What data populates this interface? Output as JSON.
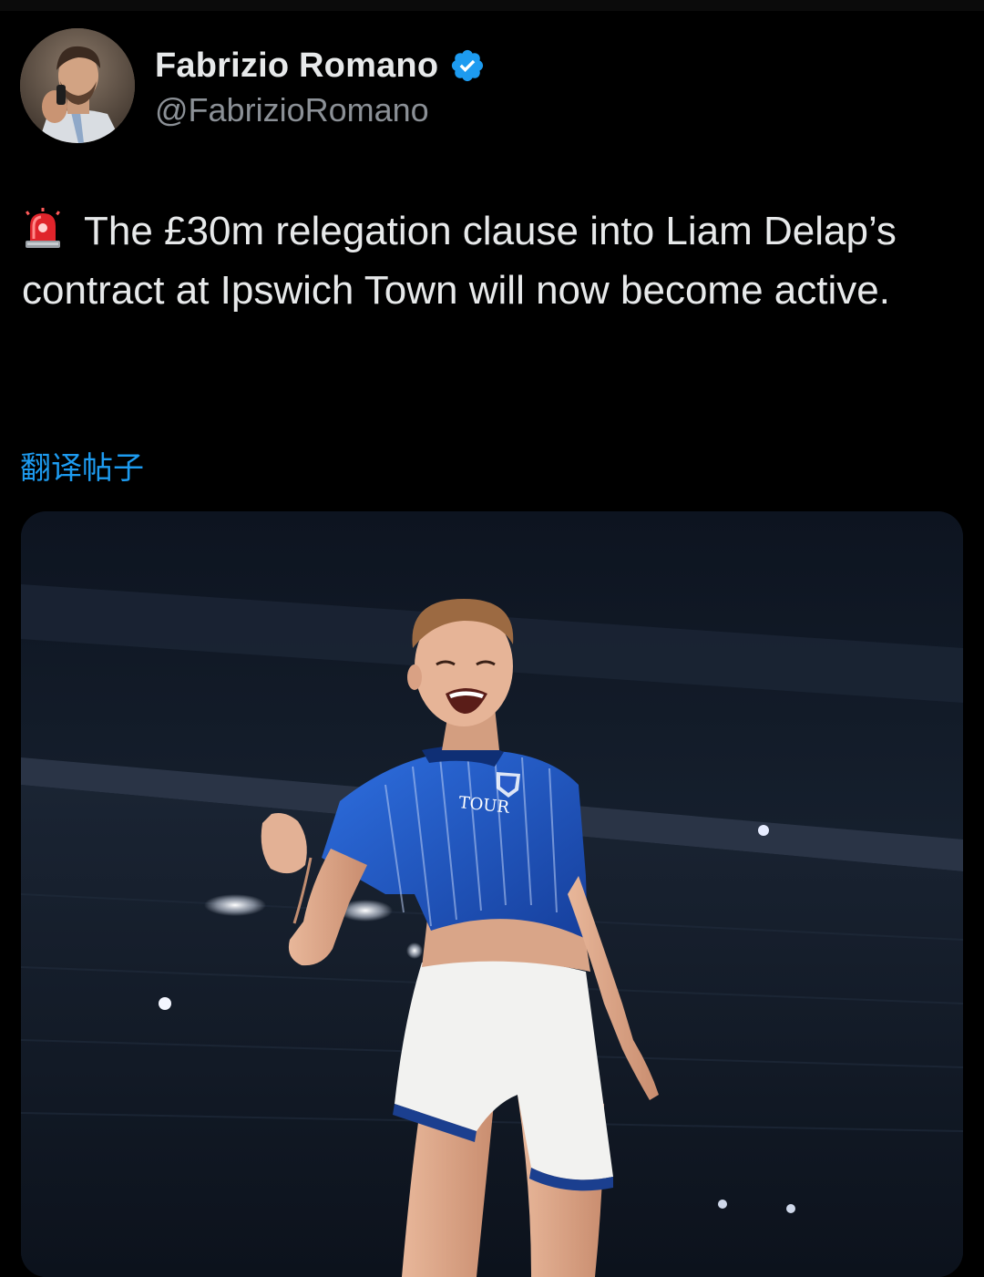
{
  "author": {
    "display_name": "Fabrizio Romano",
    "handle": "@FabrizioRomano",
    "verified": true,
    "verified_color": "#1d9bf0"
  },
  "tweet": {
    "emoji": "siren-icon",
    "text": "The £30m relegation clause into Liam Delap’s contract at Ipswich Town will now become active."
  },
  "translate_label": "翻译帖子",
  "media": {
    "type": "photo",
    "shirt_text": "TOUR"
  },
  "colors": {
    "background": "#000000",
    "text": "#e7e9ea",
    "secondary": "#8b9096",
    "link": "#1d9bf0",
    "kit_blue": "#1f55c4"
  }
}
